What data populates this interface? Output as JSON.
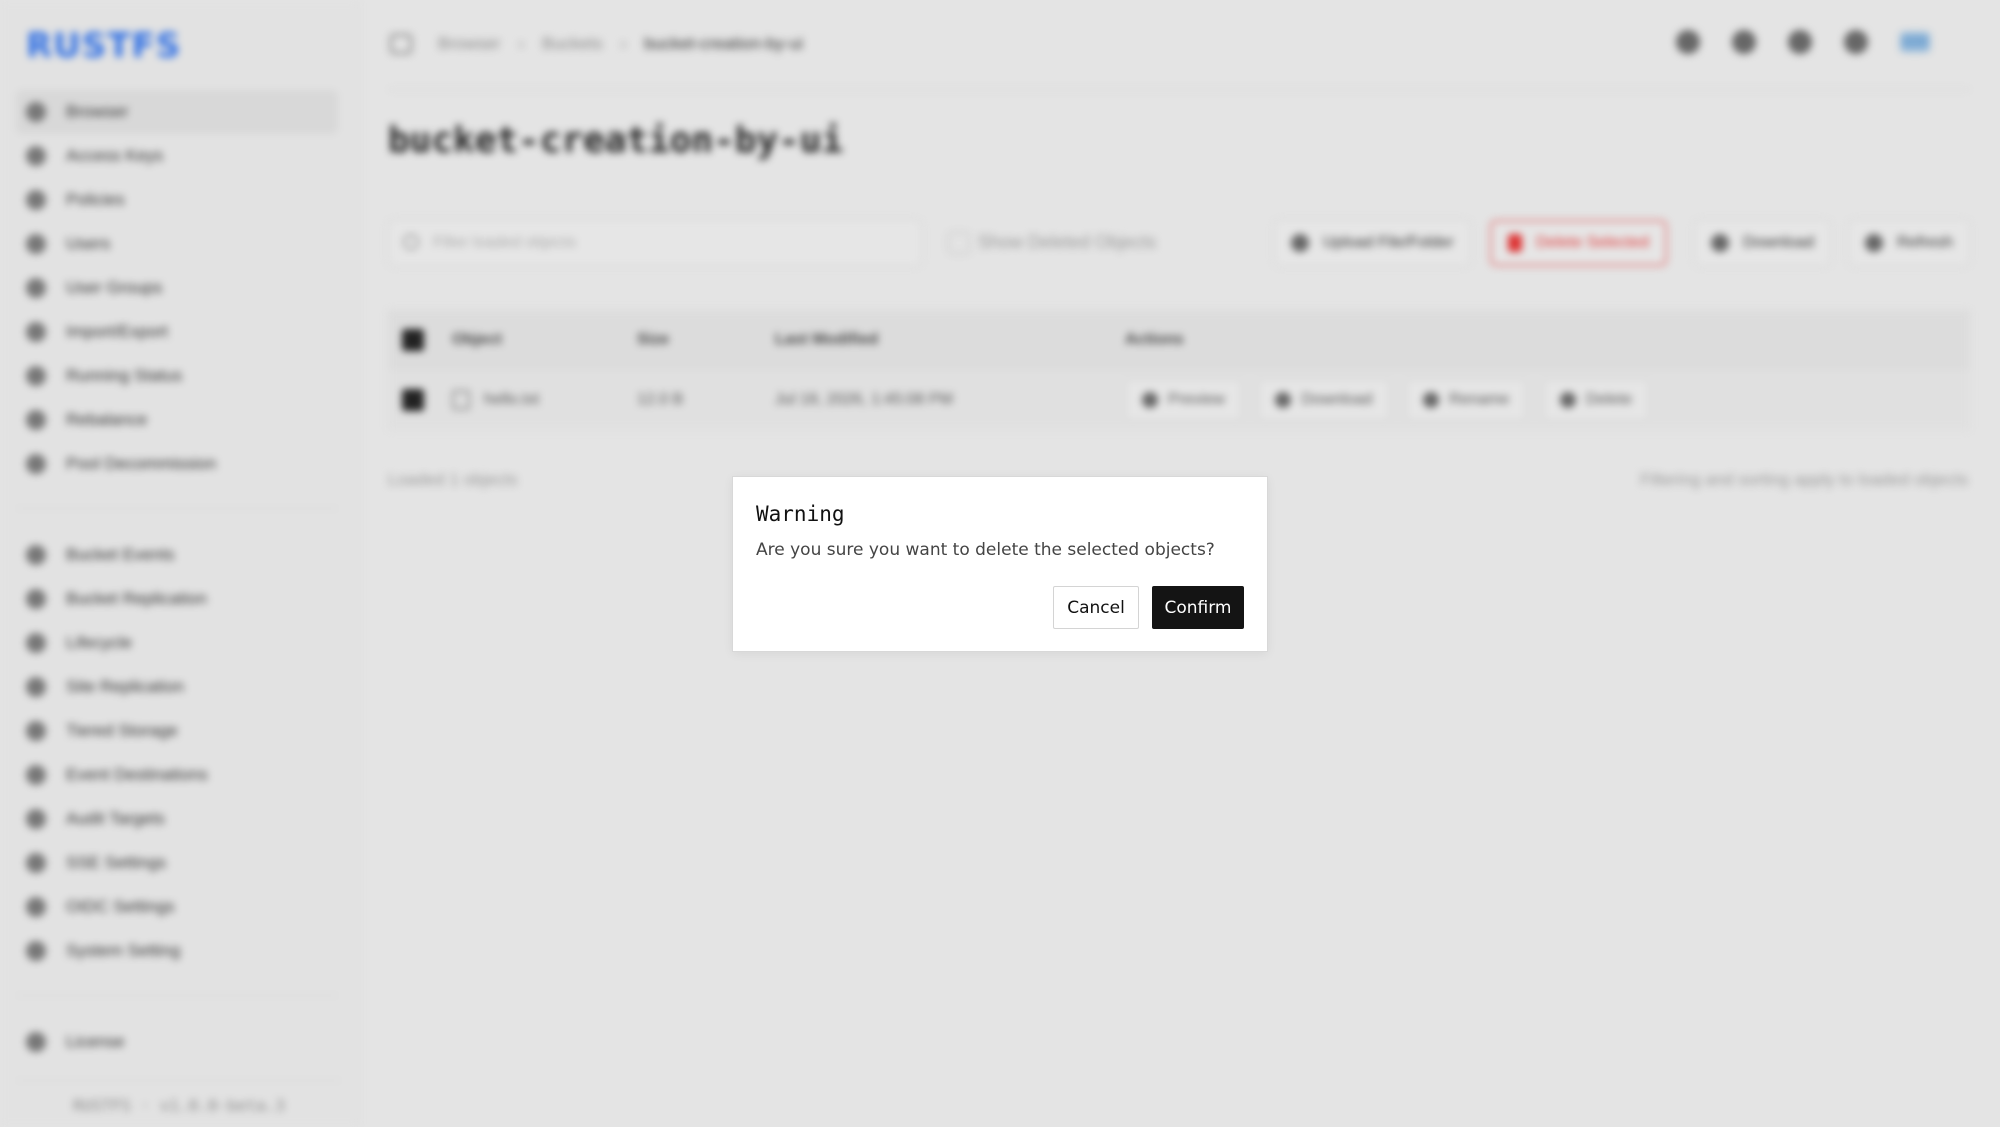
{
  "app": {
    "logo": "RUSTFS",
    "version": "RUSTFS · v1.0.0-beta.3"
  },
  "sidebar": {
    "primary": [
      {
        "label": "Browser",
        "icon": "folder-icon",
        "active": true
      },
      {
        "label": "Access Keys",
        "icon": "key-icon"
      },
      {
        "label": "Policies",
        "icon": "shield-icon"
      },
      {
        "label": "Users",
        "icon": "user-icon"
      },
      {
        "label": "User Groups",
        "icon": "users-icon"
      },
      {
        "label": "Import/Export",
        "icon": "import-icon"
      },
      {
        "label": "Running Status",
        "icon": "chart-icon"
      },
      {
        "label": "Rebalance",
        "icon": "refresh-icon"
      },
      {
        "label": "Pool Decommission",
        "icon": "trash-icon"
      }
    ],
    "secondary": [
      {
        "label": "Bucket Events",
        "icon": "events-icon"
      },
      {
        "label": "Bucket Replication",
        "icon": "copy-icon"
      },
      {
        "label": "Lifecycle",
        "icon": "cycle-icon"
      },
      {
        "label": "Site Replication",
        "icon": "globe-icon"
      },
      {
        "label": "Tiered Storage",
        "icon": "layers-icon"
      },
      {
        "label": "Event Destinations",
        "icon": "target-icon"
      },
      {
        "label": "Audit Targets",
        "icon": "audit-icon"
      },
      {
        "label": "SSE Settings",
        "icon": "lock-icon"
      },
      {
        "label": "OIDC Settings",
        "icon": "id-icon"
      },
      {
        "label": "System Setting",
        "icon": "gear-icon"
      }
    ],
    "bottom": [
      {
        "label": "License",
        "icon": "license-icon"
      }
    ]
  },
  "topbar": {
    "breadcrumb": [
      "Browser",
      "Buckets",
      "bucket-creation-by-ui"
    ],
    "avatar": "ADM"
  },
  "main": {
    "title": "bucket-creation-by-ui",
    "search_placeholder": "Filter loaded objects",
    "show_deleted_label": "Show Deleted Objects",
    "buttons": {
      "upload": "Upload File/Folder",
      "delete_selected": "Delete Selected",
      "download": "Download",
      "refresh": "Refresh"
    },
    "table": {
      "headers": {
        "object": "Object",
        "size": "Size",
        "last_modified": "Last Modified",
        "actions": "Actions"
      },
      "rows": [
        {
          "object": "hello.txt",
          "size": "12.0 B",
          "last_modified": "Jul 18, 2026, 1:45:08 PM"
        }
      ],
      "row_actions": [
        "Preview",
        "Download",
        "Rename",
        "Delete"
      ]
    },
    "footer_left": "Loaded 1 objects",
    "footer_right": "Filtering and sorting apply to loaded objects"
  },
  "dialog": {
    "title": "Warning",
    "message": "Are you sure you want to delete the selected objects?",
    "cancel_label": "Cancel",
    "confirm_label": "Confirm"
  },
  "colors": {
    "accent": "#2f6fe4",
    "danger": "#d33333",
    "confirm_bg": "#141414",
    "overlay": "#e4e4e4"
  }
}
